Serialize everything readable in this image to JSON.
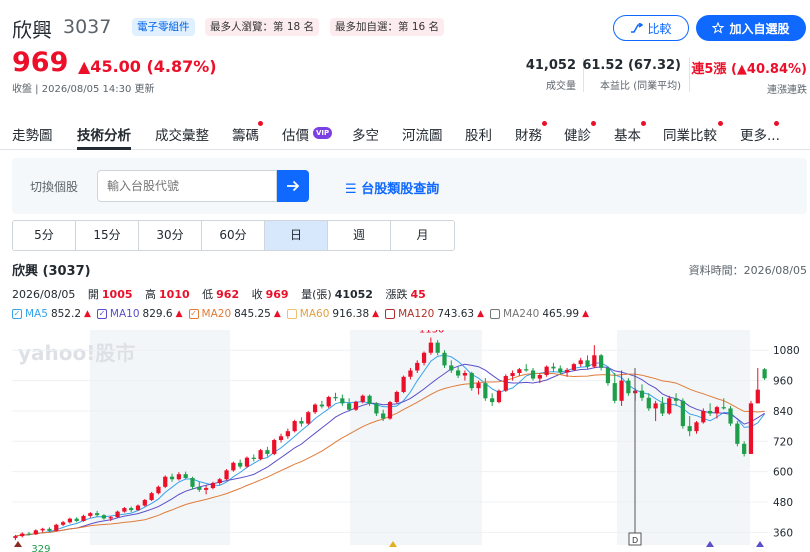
{
  "header": {
    "name": "欣興",
    "code": "3037",
    "category_tag": "電子零組件",
    "rank_tags": [
      "最多人瀏覽：第 18 名",
      "最多加自選：第 16 名"
    ],
    "compare_label": "比較",
    "add_watchlist_label": "加入自選股",
    "price": "969",
    "change": "▲45.00 (4.87%)",
    "updated": "收盤 | 2026/08/05 14:30 更新",
    "stats": [
      {
        "value": "41,052",
        "label": "成交量"
      },
      {
        "value": "61.52 (67.32)",
        "label": "本益比 (同業平均)"
      },
      {
        "value": "連5漲 (▲40.84%)",
        "label": "連漲連跌"
      }
    ]
  },
  "tabs": [
    "走勢圖",
    "技術分析",
    "成交彙整",
    "籌碼",
    "估價",
    "多空",
    "河流圖",
    "股利",
    "財務",
    "健診",
    "基本",
    "同業比較",
    "更多..."
  ],
  "vip_badge": "VIP",
  "search": {
    "label": "切換個股",
    "placeholder": "輸入台股代號",
    "category_link": "台股類股查詢"
  },
  "periods": [
    "5分",
    "15分",
    "30分",
    "60分",
    "日",
    "週",
    "月"
  ],
  "active_period": "日",
  "chart_header": {
    "title": "欣興 (3037)",
    "data_time": "資料時間：2026/08/05",
    "date": "2026/08/05",
    "open_label": "開",
    "open": "1005",
    "high_label": "高",
    "high": "1010",
    "low_label": "低",
    "low": "962",
    "close_label": "收",
    "close": "969",
    "volume_label": "量(張)",
    "volume": "41052",
    "change_label": "漲跌",
    "change": "45"
  },
  "ma_legend": [
    {
      "name": "MA5",
      "value": "852.2",
      "color": "#36a2eb"
    },
    {
      "name": "MA10",
      "value": "829.6",
      "color": "#5b4fc9"
    },
    {
      "name": "MA20",
      "value": "845.25",
      "color": "#e07b39"
    },
    {
      "name": "MA60",
      "value": "916.38",
      "color": "#f0c070"
    },
    {
      "name": "MA120",
      "value": "743.63",
      "color": "#b0332b"
    },
    {
      "name": "MA240",
      "value": "465.99",
      "color": "#777777"
    }
  ],
  "chart_data": {
    "type": "candlestick",
    "watermark": "yahoo!股市",
    "y_ticks": [
      1080,
      960,
      840,
      720,
      600,
      480,
      360
    ],
    "ylim": [
      310,
      1160
    ],
    "annotations": [
      {
        "label": "1130",
        "kind": "high"
      },
      {
        "label": "329",
        "kind": "low"
      }
    ],
    "marker_label": "D",
    "candles": [
      [
        338,
        350,
        329,
        345
      ],
      [
        345,
        360,
        340,
        355
      ],
      [
        355,
        362,
        348,
        352
      ],
      [
        352,
        372,
        350,
        368
      ],
      [
        368,
        378,
        360,
        374
      ],
      [
        374,
        380,
        362,
        366
      ],
      [
        366,
        394,
        364,
        390
      ],
      [
        390,
        405,
        385,
        400
      ],
      [
        400,
        418,
        395,
        414
      ],
      [
        414,
        420,
        400,
        405
      ],
      [
        405,
        430,
        402,
        425
      ],
      [
        425,
        440,
        418,
        436
      ],
      [
        436,
        445,
        420,
        428
      ],
      [
        428,
        432,
        410,
        415
      ],
      [
        415,
        425,
        405,
        420
      ],
      [
        420,
        446,
        418,
        442
      ],
      [
        442,
        460,
        438,
        456
      ],
      [
        456,
        462,
        440,
        448
      ],
      [
        448,
        470,
        445,
        466
      ],
      [
        466,
        492,
        462,
        488
      ],
      [
        488,
        520,
        484,
        515
      ],
      [
        515,
        545,
        510,
        540
      ],
      [
        540,
        585,
        535,
        580
      ],
      [
        580,
        592,
        560,
        570
      ],
      [
        570,
        598,
        565,
        590
      ],
      [
        590,
        600,
        570,
        575
      ],
      [
        575,
        580,
        530,
        540
      ],
      [
        540,
        560,
        520,
        528
      ],
      [
        528,
        545,
        510,
        535
      ],
      [
        535,
        560,
        530,
        555
      ],
      [
        555,
        575,
        548,
        570
      ],
      [
        570,
        610,
        566,
        605
      ],
      [
        605,
        640,
        600,
        635
      ],
      [
        635,
        648,
        612,
        620
      ],
      [
        620,
        660,
        615,
        655
      ],
      [
        655,
        668,
        640,
        650
      ],
      [
        650,
        690,
        645,
        685
      ],
      [
        685,
        698,
        660,
        670
      ],
      [
        670,
        730,
        665,
        725
      ],
      [
        725,
        750,
        715,
        740
      ],
      [
        740,
        770,
        730,
        760
      ],
      [
        760,
        805,
        755,
        800
      ],
      [
        800,
        815,
        778,
        790
      ],
      [
        790,
        840,
        785,
        835
      ],
      [
        835,
        870,
        828,
        865
      ],
      [
        865,
        880,
        850,
        858
      ],
      [
        858,
        900,
        852,
        895
      ],
      [
        895,
        912,
        880,
        890
      ],
      [
        890,
        905,
        860,
        870
      ],
      [
        870,
        890,
        838,
        845
      ],
      [
        845,
        880,
        840,
        876
      ],
      [
        876,
        905,
        870,
        900
      ],
      [
        900,
        905,
        860,
        868
      ],
      [
        868,
        875,
        820,
        830
      ],
      [
        830,
        845,
        800,
        810
      ],
      [
        810,
        880,
        805,
        875
      ],
      [
        875,
        920,
        870,
        915
      ],
      [
        915,
        980,
        910,
        975
      ],
      [
        975,
        1010,
        965,
        1000
      ],
      [
        1000,
        1040,
        990,
        1030
      ],
      [
        1030,
        1075,
        1020,
        1070
      ],
      [
        1070,
        1130,
        1062,
        1110
      ],
      [
        1110,
        1120,
        1060,
        1070
      ],
      [
        1070,
        1080,
        1010,
        1020
      ],
      [
        1020,
        1040,
        990,
        1000
      ],
      [
        1000,
        1015,
        970,
        980
      ],
      [
        980,
        1000,
        960,
        990
      ],
      [
        990,
        995,
        920,
        930
      ],
      [
        930,
        960,
        905,
        950
      ],
      [
        950,
        970,
        880,
        890
      ],
      [
        890,
        910,
        860,
        875
      ],
      [
        875,
        925,
        870,
        920
      ],
      [
        920,
        985,
        915,
        978
      ],
      [
        978,
        1000,
        960,
        990
      ],
      [
        990,
        1010,
        980,
        1005
      ],
      [
        1005,
        1025,
        995,
        1000
      ],
      [
        1000,
        1010,
        960,
        968
      ],
      [
        968,
        990,
        950,
        982
      ],
      [
        982,
        1020,
        975,
        1015
      ],
      [
        1015,
        1030,
        995,
        1008
      ],
      [
        1008,
        1020,
        985,
        992
      ],
      [
        992,
        1010,
        975,
        1002
      ],
      [
        1002,
        1030,
        998,
        1025
      ],
      [
        1025,
        1050,
        1015,
        1040
      ],
      [
        1040,
        1060,
        1005,
        1015
      ],
      [
        1015,
        1100,
        1010,
        1060
      ],
      [
        1060,
        1065,
        1000,
        1010
      ],
      [
        1010,
        1015,
        940,
        950
      ],
      [
        950,
        990,
        870,
        880
      ],
      [
        880,
        1000,
        860,
        960
      ],
      [
        960,
        970,
        900,
        910
      ],
      [
        910,
        930,
        880,
        920
      ],
      [
        920,
        945,
        880,
        892
      ],
      [
        892,
        910,
        840,
        850
      ],
      [
        850,
        880,
        800,
        870
      ],
      [
        870,
        895,
        820,
        830
      ],
      [
        830,
        900,
        825,
        890
      ],
      [
        890,
        910,
        860,
        880
      ],
      [
        880,
        890,
        770,
        780
      ],
      [
        780,
        820,
        740,
        760
      ],
      [
        760,
        800,
        750,
        795
      ],
      [
        795,
        850,
        790,
        840
      ],
      [
        840,
        870,
        820,
        830
      ],
      [
        830,
        860,
        810,
        855
      ],
      [
        855,
        890,
        845,
        850
      ],
      [
        850,
        860,
        780,
        790
      ],
      [
        790,
        800,
        700,
        710
      ],
      [
        710,
        720,
        660,
        670
      ],
      [
        670,
        880,
        860,
        870
      ],
      [
        870,
        1010,
        870,
        924
      ],
      [
        1005,
        1010,
        962,
        969
      ]
    ]
  }
}
